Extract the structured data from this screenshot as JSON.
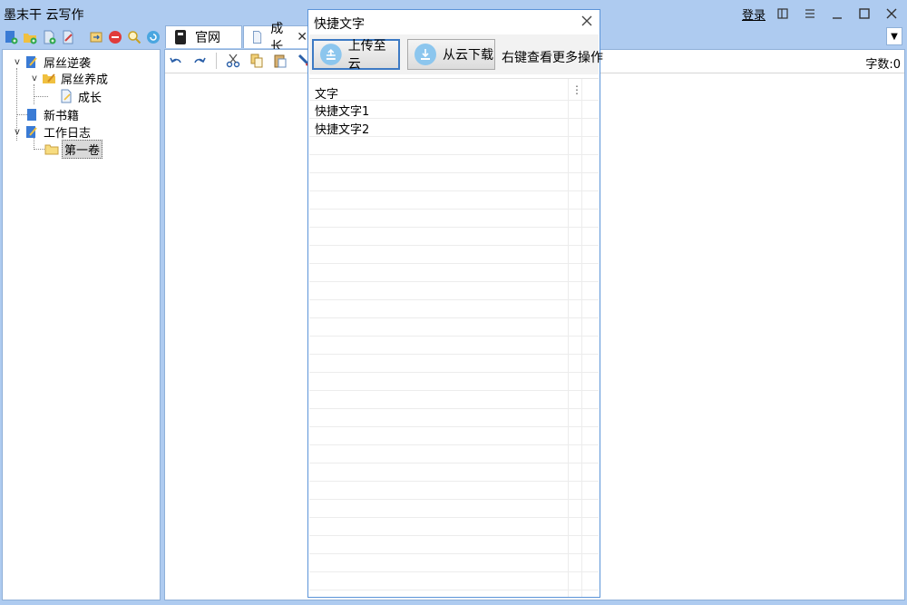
{
  "app": {
    "title": "墨末干 云写作"
  },
  "titlebar": {
    "login_label": "登录"
  },
  "tree": {
    "items": [
      {
        "label": "屌丝逆袭"
      },
      {
        "label": "屌丝养成"
      },
      {
        "label": "成长"
      },
      {
        "label": "新书籍"
      },
      {
        "label": "工作日志"
      },
      {
        "label": "第一卷"
      }
    ]
  },
  "tabs": [
    {
      "label": "官网"
    },
    {
      "label": "成长"
    }
  ],
  "editor": {
    "word_count": "字数:0"
  },
  "dialog": {
    "title": "快捷文字",
    "upload_label": "上传至云",
    "download_label": "从云下载",
    "hint": "右键查看更多操作",
    "column_header": "文字",
    "rows": [
      "快捷文字1",
      "快捷文字2"
    ]
  },
  "colors": {
    "background": "#aecbf0",
    "border": "#8fb0d8",
    "dialog_border": "#5b94d8",
    "accent": "#3d7ac4"
  }
}
